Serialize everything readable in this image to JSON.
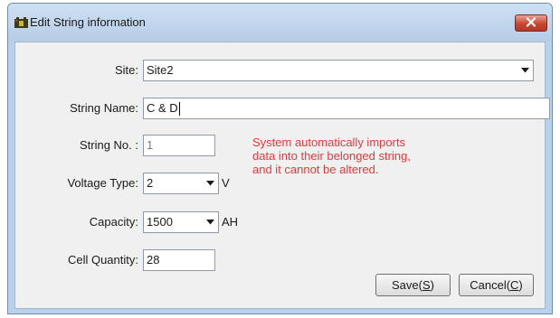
{
  "window": {
    "title": "Edit String information",
    "icon": "app-battery-icon",
    "close_icon": "close-icon"
  },
  "form": {
    "site": {
      "label": "Site:",
      "value": "Site2"
    },
    "string_name": {
      "label": "String Name:",
      "value": "C & D"
    },
    "string_no": {
      "label": "String No. :",
      "value": "1"
    },
    "voltage_type": {
      "label": "Voltage Type:",
      "value": "2",
      "unit": "V"
    },
    "capacity": {
      "label": "Capacity:",
      "value": "1500",
      "unit": "AH"
    },
    "cell_quantity": {
      "label": "Cell Quantity:",
      "value": "28"
    }
  },
  "notice": {
    "line1": "System automatically imports",
    "line2": "data into their belonged string,",
    "line3": "and it cannot be altered.",
    "color": "#e8373a"
  },
  "buttons": {
    "save": {
      "text": "Save(",
      "key": "S",
      "close": ")"
    },
    "cancel": {
      "text": "Cancel(",
      "key": "C",
      "close": ")"
    }
  }
}
